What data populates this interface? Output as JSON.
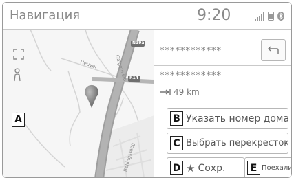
{
  "header": {
    "title": "Навигация",
    "time": "9:20"
  },
  "status_icons": [
    "signal-icon",
    "phone-icon",
    "bluetooth-icon"
  ],
  "map": {
    "road_labels": [
      "Heuvel",
      "Galgenveld",
      "N19a",
      "R14",
      "Bellingsteeg"
    ],
    "expand_icon": "expand-icon",
    "person_icon": "person-icon",
    "pin_icon": "location-pin-icon"
  },
  "route": {
    "line1": "************",
    "line2": "************",
    "distance": "49 km"
  },
  "labels": {
    "a": "A",
    "b": "B",
    "c": "C",
    "d": "D",
    "e": "E"
  },
  "buttons": {
    "house_number": "Указать номер дома",
    "intersection": "Выбрать перекресток",
    "save": "Сохр.",
    "go": "Поехали"
  }
}
